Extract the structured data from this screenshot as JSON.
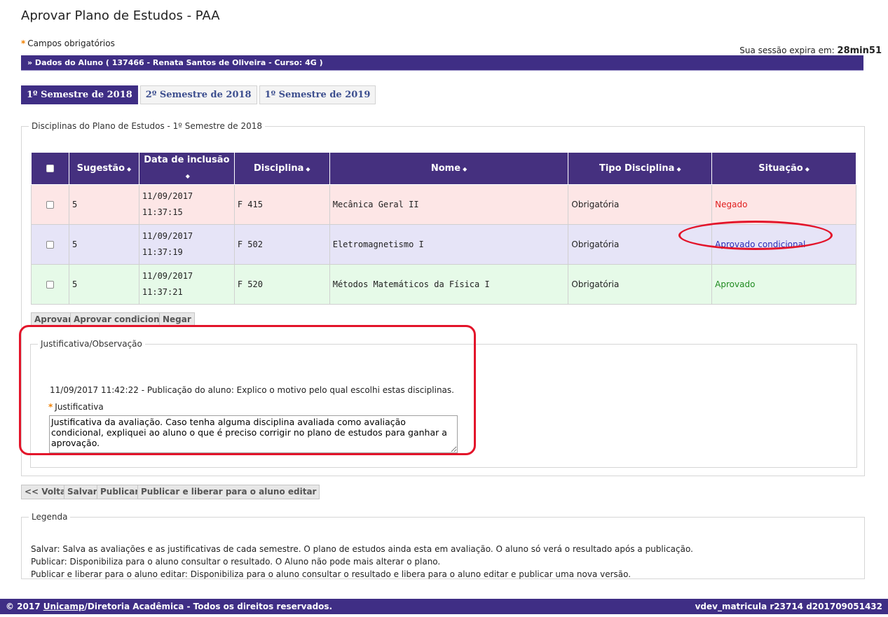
{
  "page": {
    "title": "Aprovar Plano de Estudos - PAA",
    "required_note": "Campos obrigatórios",
    "session_label": "Sua sessão expira em:",
    "session_time": "28min51"
  },
  "student_bar": "»  Dados do Aluno ( 137466 - Renata Santos de Oliveira - Curso: 4G )",
  "tabs": [
    {
      "label": "1º Semestre de 2018",
      "active": true
    },
    {
      "label": "2º Semestre de 2018",
      "active": false
    },
    {
      "label": "1º Semestre de 2019",
      "active": false
    }
  ],
  "disciplinas": {
    "legend": "Disciplinas do Plano de Estudos - 1º Semestre de 2018",
    "columns": [
      "Sugestão",
      "Data de inclusão",
      "Disciplina",
      "Nome",
      "Tipo Disciplina",
      "Situação"
    ],
    "sort_glyph": "◆",
    "rows": [
      {
        "sugestao": "5",
        "data": "11/09/2017",
        "hora": "11:37:15",
        "disciplina": "F 415",
        "nome": "Mecânica Geral II",
        "tipo": "Obrigatória",
        "situacao": "Negado",
        "status_color": "#e02020"
      },
      {
        "sugestao": "5",
        "data": "11/09/2017",
        "hora": "11:37:19",
        "disciplina": "F 502",
        "nome": "Eletromagnetismo I",
        "tipo": "Obrigatória",
        "situacao": "Aprovado condicional",
        "status_color": "#2a2ab8"
      },
      {
        "sugestao": "5",
        "data": "11/09/2017",
        "hora": "11:37:21",
        "disciplina": "F 520",
        "nome": "Métodos Matemáticos da Física I",
        "tipo": "Obrigatória",
        "situacao": "Aprovado",
        "status_color": "#1f8a1f"
      }
    ],
    "buttons": {
      "aprovar": "Aprovar",
      "aprovar_condicional": "Aprovar condicional",
      "negar": "Negar"
    }
  },
  "justificativa": {
    "legend": "Justificativa/Observação",
    "publication_line": "11/09/2017 11:42:22 - Publicação do aluno: Explico o motivo pelo qual escolhi estas disciplinas.",
    "label": "Justificativa",
    "value": "Justificativa da avaliação. Caso tenha alguma disciplina avaliada como avaliação condicional, expliquei ao aluno o que é preciso corrigir no plano de estudos para ganhar a aprovação."
  },
  "actions": {
    "voltar": "<< Voltar",
    "salvar": "Salvar",
    "publicar": "Publicar",
    "publicar_liberar": "Publicar e liberar para o aluno editar"
  },
  "legenda": {
    "legend": "Legenda",
    "lines": [
      "Salvar: Salva as avaliações e as justificativas de cada semestre. O plano de estudos ainda esta em avaliação. O aluno só verá o resultado após a publicação.",
      "Publicar: Disponibiliza para o aluno consultar o resultado. O Aluno não pode mais alterar o plano.",
      "Publicar e liberar para o aluno editar: Disponibiliza para o aluno consultar o resultado e libera para o aluno editar e publicar uma nova versão."
    ]
  },
  "footer": {
    "copyright_prefix": "© 2017 ",
    "link": "Unicamp",
    "copyright_suffix": "/Diretoria Acadêmica - Todos os direitos reservados.",
    "version": "vdev_matricula r23714 d201709051432"
  }
}
